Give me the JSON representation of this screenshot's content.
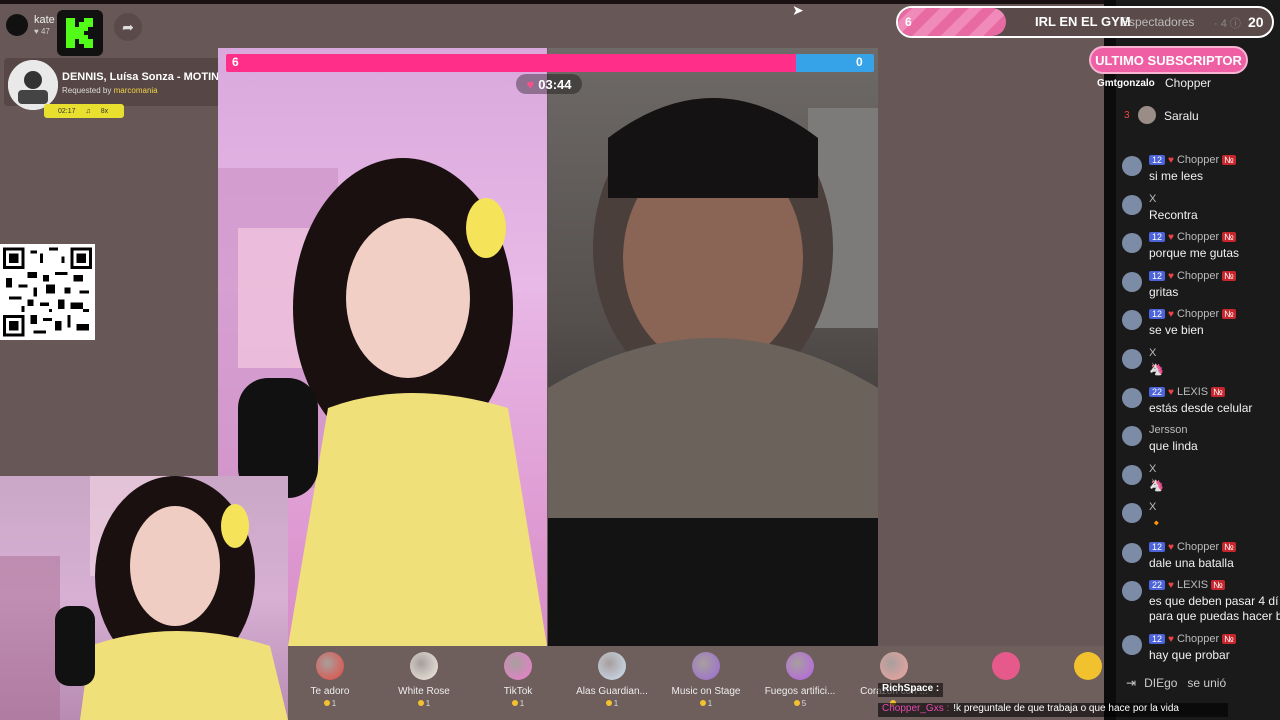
{
  "streamer": {
    "name": "kate",
    "likes": "47"
  },
  "song": {
    "title": "DENNIS, Luísa Sonza - MOTINHA 2.0 (Mete March...",
    "requested_prefix": "Requested by",
    "requested_by": "marcomania",
    "elapsed": "02:17",
    "queue": "8x"
  },
  "battle": {
    "score_left": "6",
    "score_right": "0",
    "timer": "03:44"
  },
  "goal": {
    "left": "6",
    "label": "IRL EN EL GYM",
    "right": "20"
  },
  "viewers": {
    "label": "Espectadores",
    "count": "4"
  },
  "subscriber": {
    "badge": "ULTIMO SUBSCRIPTOR",
    "name": "Gmtgonzalo",
    "name2": "Chopper"
  },
  "leaderboard": {
    "rank": "3",
    "name": "Saralu"
  },
  "chat": [
    {
      "user": "Chopper",
      "level": "12",
      "text": "si me lees"
    },
    {
      "user": "X",
      "level": "",
      "text": "Recontra"
    },
    {
      "user": "Chopper",
      "level": "12",
      "text": "porque me gutas"
    },
    {
      "user": "Chopper",
      "level": "12",
      "text": "gritas"
    },
    {
      "user": "Chopper",
      "level": "12",
      "text": "se ve bien"
    },
    {
      "user": "X",
      "level": "",
      "text": "🦄"
    },
    {
      "user": "LEXIS",
      "level": "22",
      "text": "estás desde celular"
    },
    {
      "user": "Jersson",
      "level": "",
      "text": "que linda"
    },
    {
      "user": "X",
      "level": "",
      "text": "🦄"
    },
    {
      "user": "X",
      "level": "",
      "text": "🔸"
    },
    {
      "user": "Chopper",
      "level": "12",
      "text": "dale una batalla"
    },
    {
      "user": "LEXIS",
      "level": "22",
      "text": "es que deben pasar 4 dí",
      "text2": "para que puedas hacer b"
    },
    {
      "user": "Chopper",
      "level": "12",
      "text": "hay que probar"
    }
  ],
  "joined": {
    "user": "DIEgo",
    "text": "se unió"
  },
  "gifts": [
    {
      "label": "Te adoro",
      "cost": "1",
      "color": "#e8473f"
    },
    {
      "label": "White Rose",
      "cost": "1",
      "color": "#f4efe2"
    },
    {
      "label": "TikTok",
      "cost": "1",
      "color": "#f17bd2"
    },
    {
      "label": "Alas Guardian...",
      "cost": "1",
      "color": "#cfe3f5"
    },
    {
      "label": "Music on Stage",
      "cost": "1",
      "color": "#9c6ad8"
    },
    {
      "label": "Fuegos artifici...",
      "cost": "5",
      "color": "#b760ea"
    },
    {
      "label": "Corazón con ...",
      "cost": "",
      "color": "#f2a4a0"
    }
  ],
  "ticker": {
    "richspace": "RichSpace :",
    "user": "Chopper_Gxs :",
    "message": "!k preguntale de que trabaja o que hace por la vida"
  },
  "colors": {
    "accent_pink": "#ff2f89",
    "accent_blue": "#36a3e9",
    "kick_green": "#53fc18"
  }
}
